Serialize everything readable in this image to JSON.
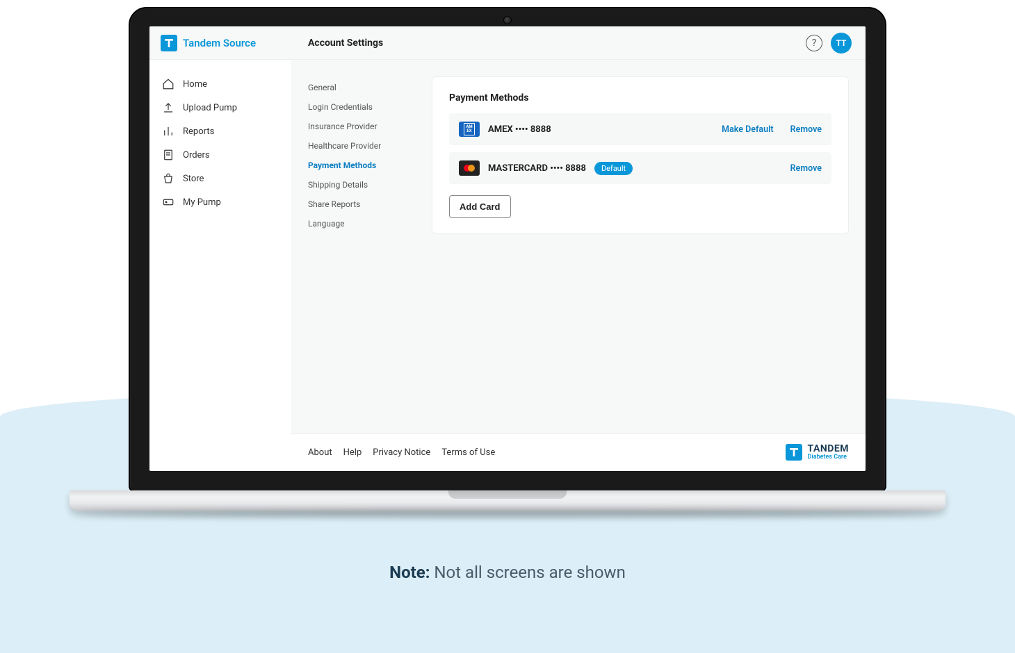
{
  "brand": {
    "name": "Tandem Source"
  },
  "header": {
    "title": "Account Settings",
    "avatar_initials": "TT"
  },
  "sidebar": {
    "items": [
      {
        "label": "Home"
      },
      {
        "label": "Upload Pump"
      },
      {
        "label": "Reports"
      },
      {
        "label": "Orders"
      },
      {
        "label": "Store"
      },
      {
        "label": "My Pump"
      }
    ]
  },
  "subnav": {
    "items": [
      {
        "label": "General"
      },
      {
        "label": "Login Credentials"
      },
      {
        "label": "Insurance Provider"
      },
      {
        "label": "Healthcare Provider"
      },
      {
        "label": "Payment Methods",
        "active": true
      },
      {
        "label": "Shipping Details"
      },
      {
        "label": "Share Reports"
      },
      {
        "label": "Language"
      }
    ]
  },
  "payment_methods": {
    "title": "Payment Methods",
    "cards": [
      {
        "brand": "AMEX",
        "last4": "8888",
        "display": "AMEX •••• 8888",
        "default": false,
        "make_default_label": "Make Default",
        "remove_label": "Remove"
      },
      {
        "brand": "MASTERCARD",
        "last4": "8888",
        "display": "MASTERCARD •••• 8888",
        "default": true,
        "default_badge": "Default",
        "remove_label": "Remove"
      }
    ],
    "add_card_label": "Add Card"
  },
  "footer": {
    "links": [
      {
        "label": "About"
      },
      {
        "label": "Help"
      },
      {
        "label": "Privacy Notice"
      },
      {
        "label": "Terms of Use"
      }
    ],
    "brand_line1": "TANDEM",
    "brand_line2": "Diabetes Care"
  },
  "note": {
    "prefix": "Note:",
    "text": "Not all screens are shown"
  }
}
